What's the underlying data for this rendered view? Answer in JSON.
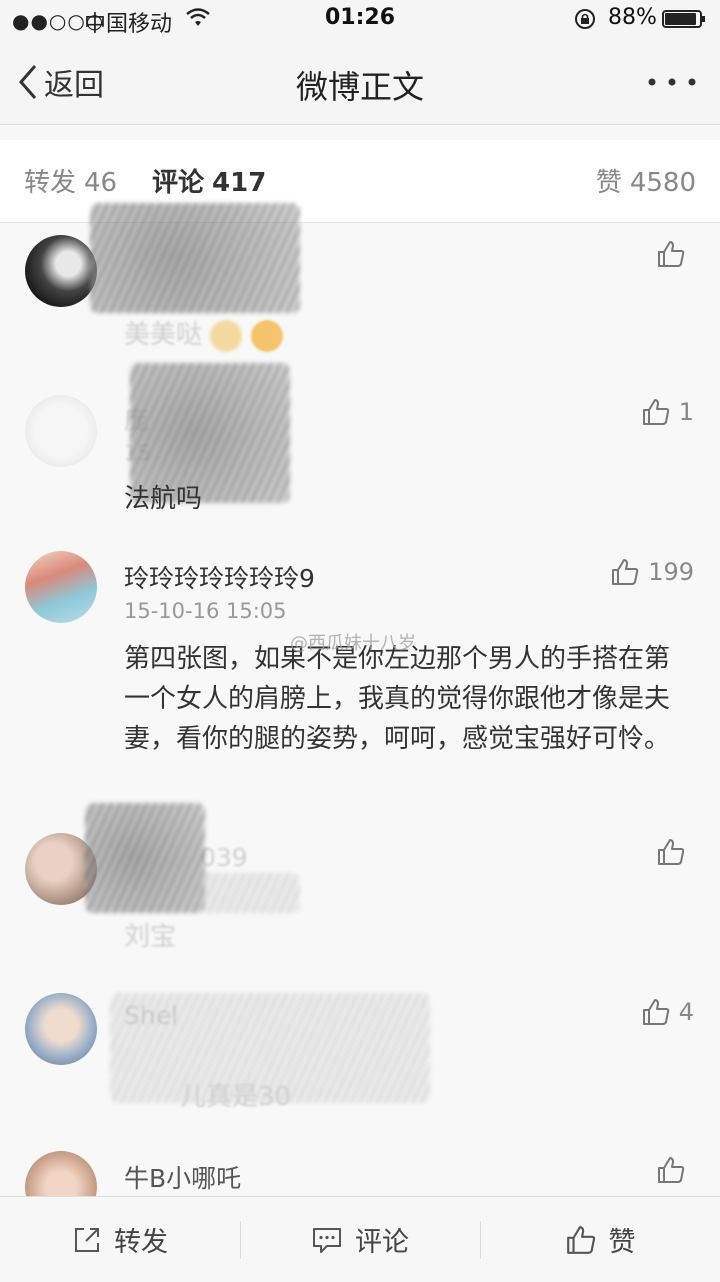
{
  "status_bar": {
    "signal": "●●○○○",
    "carrier": "中国移动",
    "time": "01:26",
    "battery_percent": "88%"
  },
  "nav": {
    "back_label": "返回",
    "title": "微博正文"
  },
  "stats": {
    "repost_label": "转发",
    "repost_count": "46",
    "comment_label": "评论",
    "comment_count": "417",
    "like_label": "赞",
    "like_count": "4580"
  },
  "comments": [
    {
      "username": "",
      "timestamp": "",
      "text": "美美哒",
      "likes": ""
    },
    {
      "username": "庞",
      "timestamp": "15",
      "text": "法航吗",
      "likes": "1"
    },
    {
      "username": "玲玲玲玲玲玲玲9",
      "timestamp": "15-10-16 15:05",
      "text": "第四张图，如果不是你左边那个男人的手搭在第一个女人的肩膀上，我真的觉得你跟他才像是夫妻，看你的腿的姿势，呵呵，感觉宝强好可怜。",
      "likes": "199"
    },
    {
      "username": "039",
      "timestamp": "",
      "text": "刘宝",
      "likes": ""
    },
    {
      "username": "Shel",
      "timestamp": "",
      "text": "儿真是30",
      "likes": "4"
    },
    {
      "username": "牛B小哪吒",
      "timestamp": "",
      "text": "",
      "likes": ""
    }
  ],
  "watermark": "@西瓜妹十八岁",
  "toolbar": {
    "repost_label": "转发",
    "comment_label": "评论",
    "like_label": "赞"
  },
  "colors": {
    "background": "#f7f7f7",
    "text": "#333333",
    "muted": "#888888"
  }
}
